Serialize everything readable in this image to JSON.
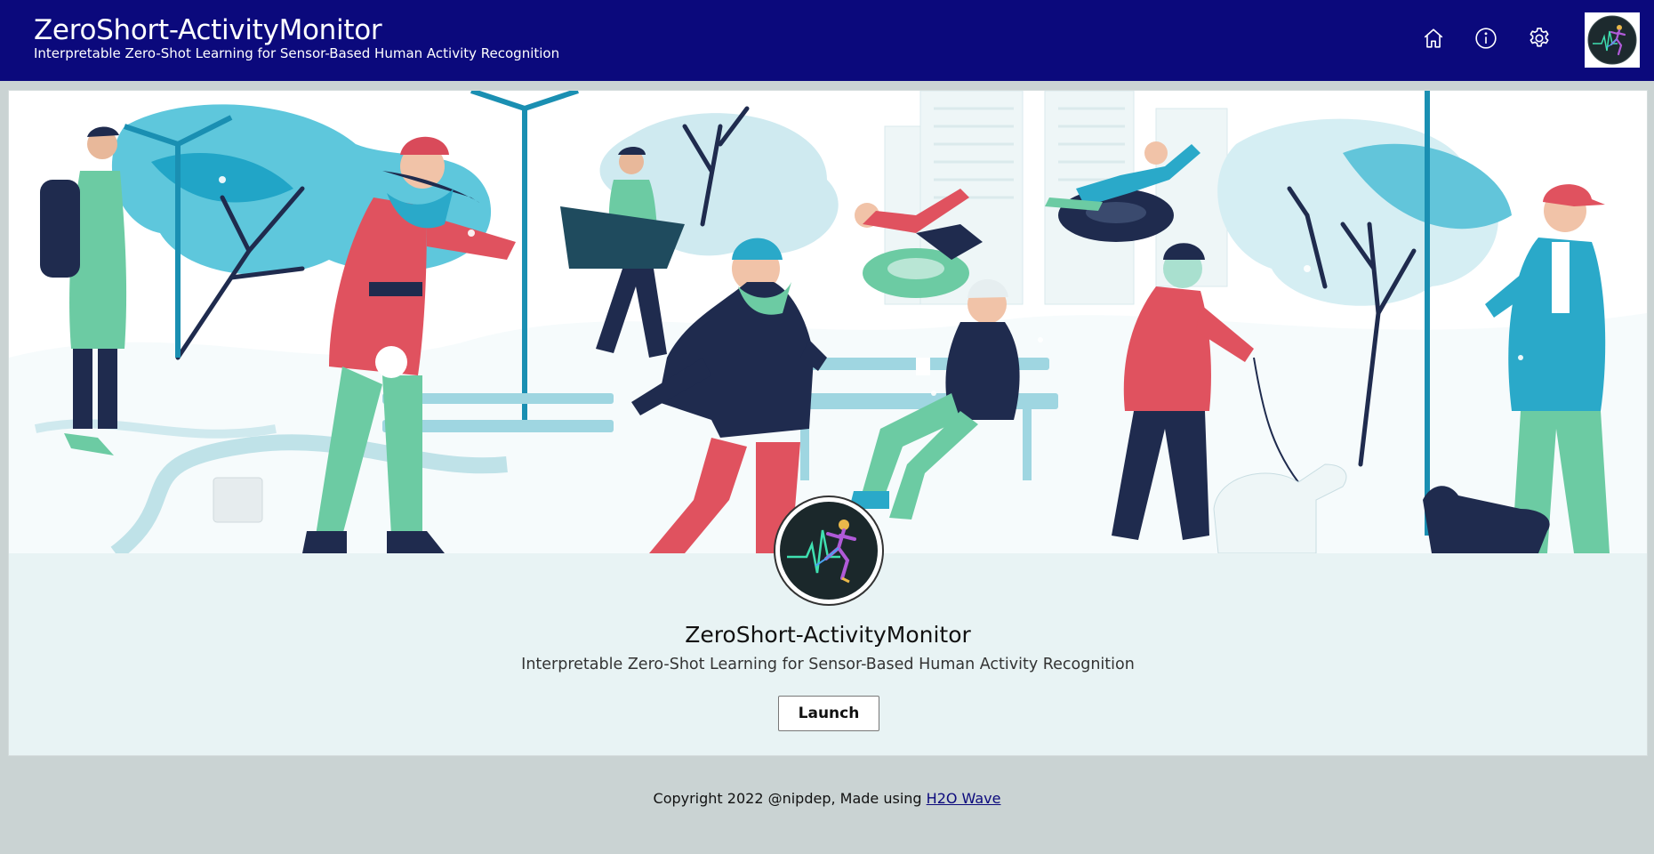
{
  "header": {
    "title": "ZeroShort-ActivityMonitor",
    "subtitle": "Interpretable Zero-Shot Learning for Sensor-Based Human Activity Recognition",
    "icons": [
      "home-icon",
      "info-icon",
      "settings-icon"
    ],
    "color": "#0b097c"
  },
  "profile": {
    "title": "ZeroShort-ActivityMonitor",
    "subtitle": "Interpretable Zero-Shot Learning for Sensor-Based Human Activity Recognition",
    "launch_label": "Launch"
  },
  "footer": {
    "text": "Copyright 2022 @nipdep, Made using ",
    "link_label": "H2O Wave"
  },
  "colors": {
    "background": "#cad3d3",
    "card": "#e8f3f4",
    "accent": "#0b097c"
  }
}
